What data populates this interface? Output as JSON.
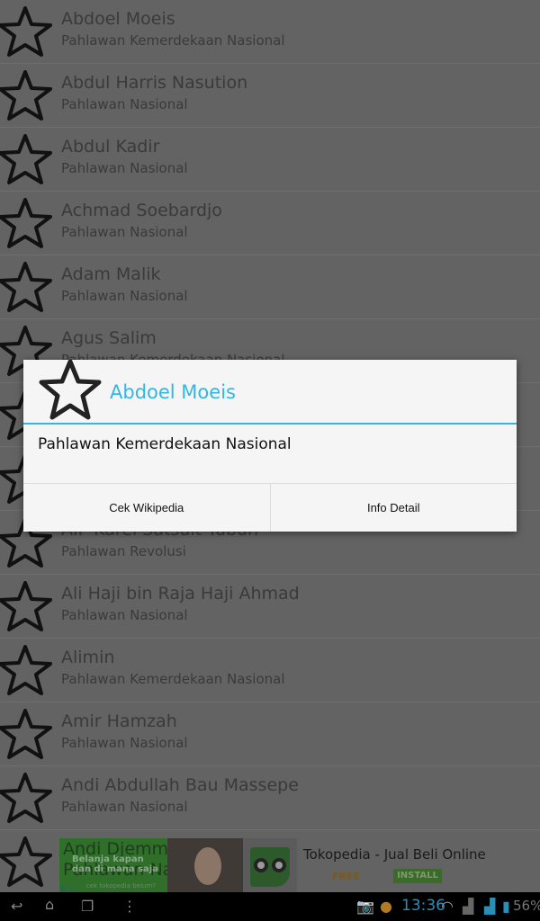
{
  "list": {
    "items": [
      {
        "name": "Abdoel Moeis",
        "category": "Pahlawan Kemerdekaan Nasional"
      },
      {
        "name": "Abdul Harris Nasution",
        "category": "Pahlawan Nasional"
      },
      {
        "name": "Abdul Kadir",
        "category": "Pahlawan Nasional"
      },
      {
        "name": "Achmad Soebardjo",
        "category": "Pahlawan Nasional"
      },
      {
        "name": "Adam Malik",
        "category": "Pahlawan Nasional"
      },
      {
        "name": "Agus Salim",
        "category": "Pahlawan Kemerdekaan Nasional"
      },
      {
        "name": "",
        "category": ""
      },
      {
        "name": "",
        "category": ""
      },
      {
        "name": "AIP Karel Satsuit Tubun",
        "category": "Pahlawan Revolusi"
      },
      {
        "name": "Ali Haji bin Raja Haji Ahmad",
        "category": "Pahlawan Nasional"
      },
      {
        "name": "Alimin",
        "category": "Pahlawan Kemerdekaan Nasional"
      },
      {
        "name": "Amir Hamzah",
        "category": "Pahlawan Nasional"
      },
      {
        "name": "Andi Abdullah Bau Massepe",
        "category": "Pahlawan Nasional"
      },
      {
        "name": "Andi Djemma",
        "category": "Pahlawan Nasional"
      }
    ]
  },
  "dialog": {
    "title": "Abdoel Moeis",
    "message": "Pahlawan Kemerdekaan Nasional",
    "buttons": [
      "Cek Wikipedia",
      "Info Detail"
    ],
    "accent": "#33b5e5",
    "icon": "star-outline-icon"
  },
  "ad": {
    "banner_line1": "Belanja kapan dan di mana saja",
    "banner_line2": "cek tokopedia belum?",
    "title": "Tokopedia - Jual Beli Online",
    "price": "FREE",
    "install": "INSTALL"
  },
  "status_bar": {
    "time": "13:36",
    "battery": "56%"
  }
}
